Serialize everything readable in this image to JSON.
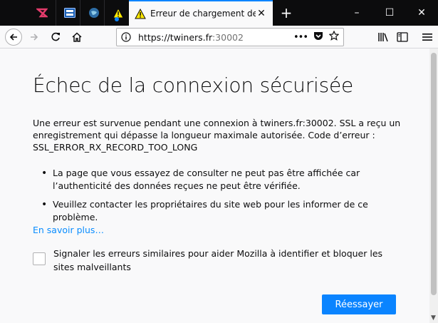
{
  "tabs": {
    "active_title": "Erreur de chargement de la pag",
    "close_glyph": "✕",
    "new_tab_glyph": "+"
  },
  "window_controls": {
    "minimize": "–",
    "maximize": "☐",
    "close": "✕"
  },
  "navbar": {
    "url_host": "https://twiners.fr",
    "url_port": ":30002",
    "more_glyph": "•••"
  },
  "page": {
    "title": "Échec de la connexion sécurisée",
    "description": "Une erreur est survenue pendant une connexion à twiners.fr:30002. SSL a reçu un enregistrement qui dépasse la longueur maximale autorisée. Code d’erreur : SSL_ERROR_RX_RECORD_TOO_LONG",
    "bullets": [
      "La page que vous essayez de consulter ne peut pas être affichée car l’authenticité des données reçues ne peut être vérifiée.",
      "Veuillez contacter les propriétaires du site web pour les informer de ce problème."
    ],
    "learn_more": "En savoir plus…",
    "checkbox_label": "Signaler les erreurs similaires pour aider Mozilla à identifier et bloquer les sites malveillants",
    "retry_button": "Réessayer"
  },
  "colors": {
    "accent": "#0a84ff",
    "link": "#0a8dff",
    "tabstrip": "#0c0c0d"
  }
}
